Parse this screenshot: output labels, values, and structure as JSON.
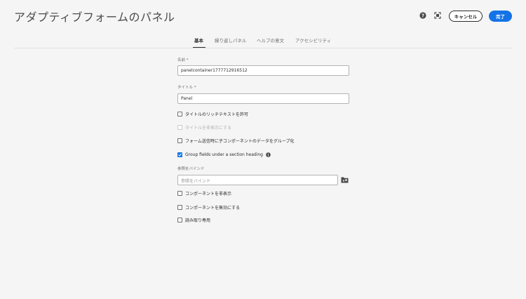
{
  "header": {
    "title": "アダプティブフォームのパネル",
    "cancel_label": "キャンセル",
    "done_label": "完了",
    "help_icon": "help-icon",
    "fullscreen_icon": "fullscreen-icon"
  },
  "tabs": [
    {
      "label": "基本",
      "active": true
    },
    {
      "label": "繰り返しパネル",
      "active": false
    },
    {
      "label": "ヘルプの意文",
      "active": false
    },
    {
      "label": "アクセシビリティ",
      "active": false
    }
  ],
  "form": {
    "name_label": "名前 *",
    "name_value": "panelcontainer1777712916512",
    "title_label": "タイトル *",
    "title_value": "Panel",
    "checkboxes": [
      {
        "label": "タイトルのリッチテキストを許可",
        "checked": false,
        "disabled": false
      },
      {
        "label": "タイトルを非表示にする",
        "checked": false,
        "disabled": true
      },
      {
        "label": "フォーム送信時に子コンポーネントのデータをグループ化",
        "checked": false,
        "disabled": false
      },
      {
        "label": "Group fields under a section heading",
        "checked": true,
        "disabled": false
      }
    ],
    "bind_ref_label": "参照をバインド",
    "bind_ref_placeholder": "参照をバインド",
    "bottom_checkboxes": [
      {
        "label": "コンポーネントを非表示",
        "checked": false
      },
      {
        "label": "コンポーネントを無効にする",
        "checked": false
      },
      {
        "label": "読み取り専用",
        "checked": false
      }
    ]
  },
  "colors": {
    "accent": "#1473e6",
    "background": "#f5f5f5"
  }
}
